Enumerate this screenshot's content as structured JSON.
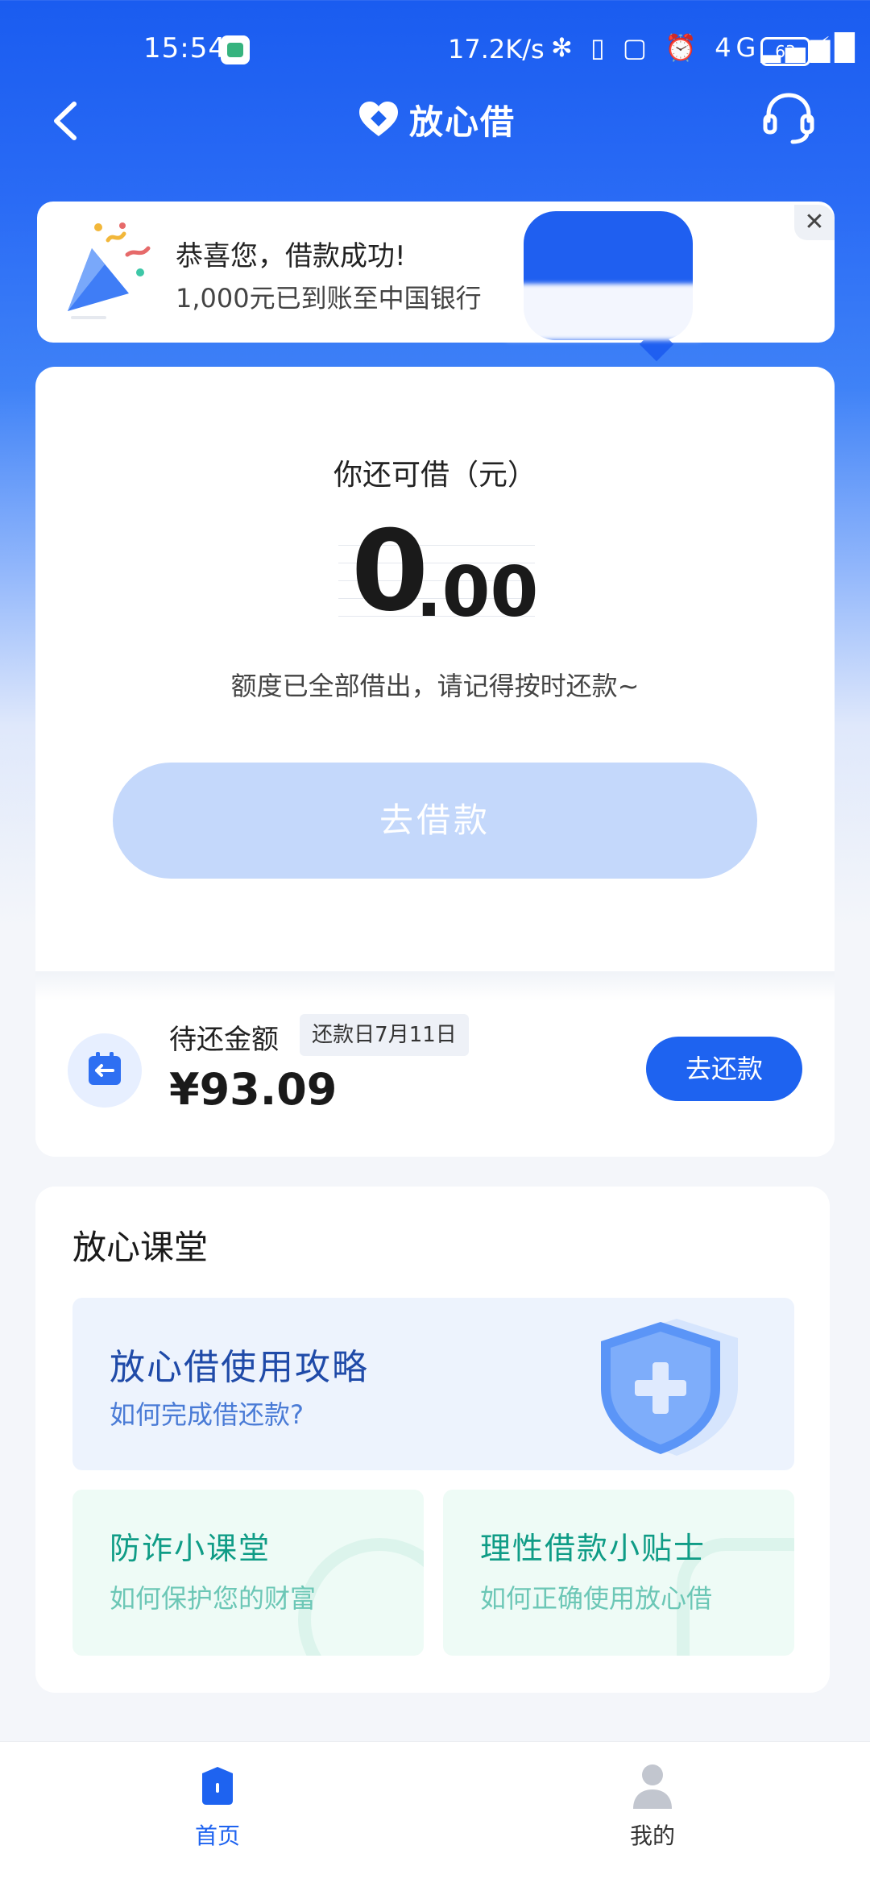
{
  "status_bar": {
    "time": "15:54",
    "network_speed": "17.2K/s",
    "icons": "✻ ▯ ▢ ⏰ 4G▂▄▆█",
    "battery": "63",
    "charging": "⚡"
  },
  "header": {
    "title": "放心借",
    "back_icon": "chevron-left-icon",
    "service_icon": "headset-icon"
  },
  "notice": {
    "title": "恭喜您，借款成功!",
    "subtitle": "1,000元已到账至中国银行",
    "close": "✕"
  },
  "borrow": {
    "label": "你还可借（元）",
    "amount_int": "0",
    "amount_dec": ".00",
    "hint": "额度已全部借出，请记得按时还款~",
    "button": "去借款"
  },
  "due": {
    "label": "待还金额",
    "due_date_badge": "还款日7月11日",
    "amount": "¥93.09",
    "button": "去还款"
  },
  "classroom": {
    "title": "放心课堂",
    "guide": {
      "title": "放心借使用攻略",
      "subtitle": "如何完成借还款?"
    },
    "tiles": [
      {
        "title": "防诈小课堂",
        "subtitle": "如何保护您的财富"
      },
      {
        "title": "理性借款小贴士",
        "subtitle": "如何正确使用放心借"
      }
    ]
  },
  "nav": {
    "home": "首页",
    "mine": "我的"
  },
  "colors": {
    "primary": "#1e63f0",
    "disabled_button": "#c4d8fb",
    "teal": "#0f9c86"
  }
}
